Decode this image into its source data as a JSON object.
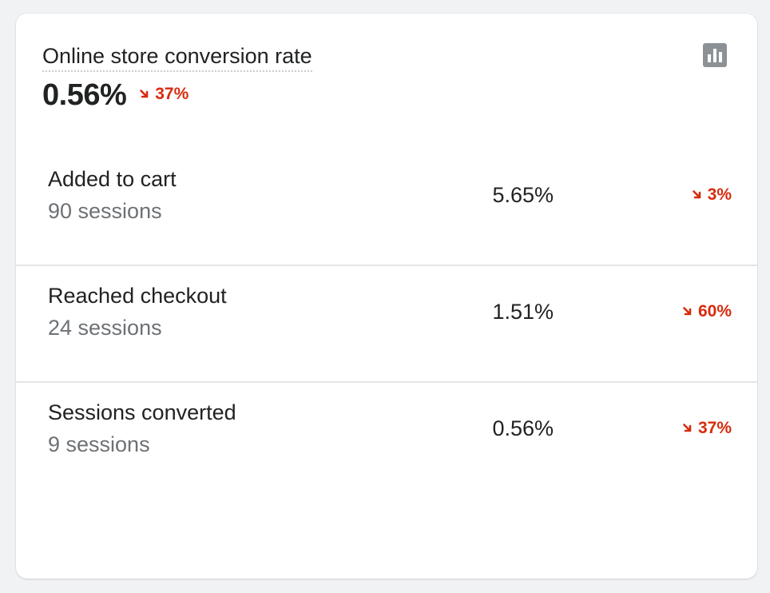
{
  "card": {
    "title": "Online store conversion rate",
    "value": "0.56%",
    "change": "37%",
    "chart_icon": "bar-chart-icon"
  },
  "rows": [
    {
      "label": "Added to cart",
      "sessions": "90 sessions",
      "value": "5.65%",
      "change": "3%"
    },
    {
      "label": "Reached checkout",
      "sessions": "24 sessions",
      "value": "1.51%",
      "change": "60%"
    },
    {
      "label": "Sessions converted",
      "sessions": "9 sessions",
      "value": "0.56%",
      "change": "37%"
    }
  ],
  "colors": {
    "negative": "#d72c0d",
    "text": "#202223",
    "subdued": "#6d7175",
    "icon": "#8c9196"
  },
  "icons": {
    "trend": "arrow-down-right-icon"
  }
}
